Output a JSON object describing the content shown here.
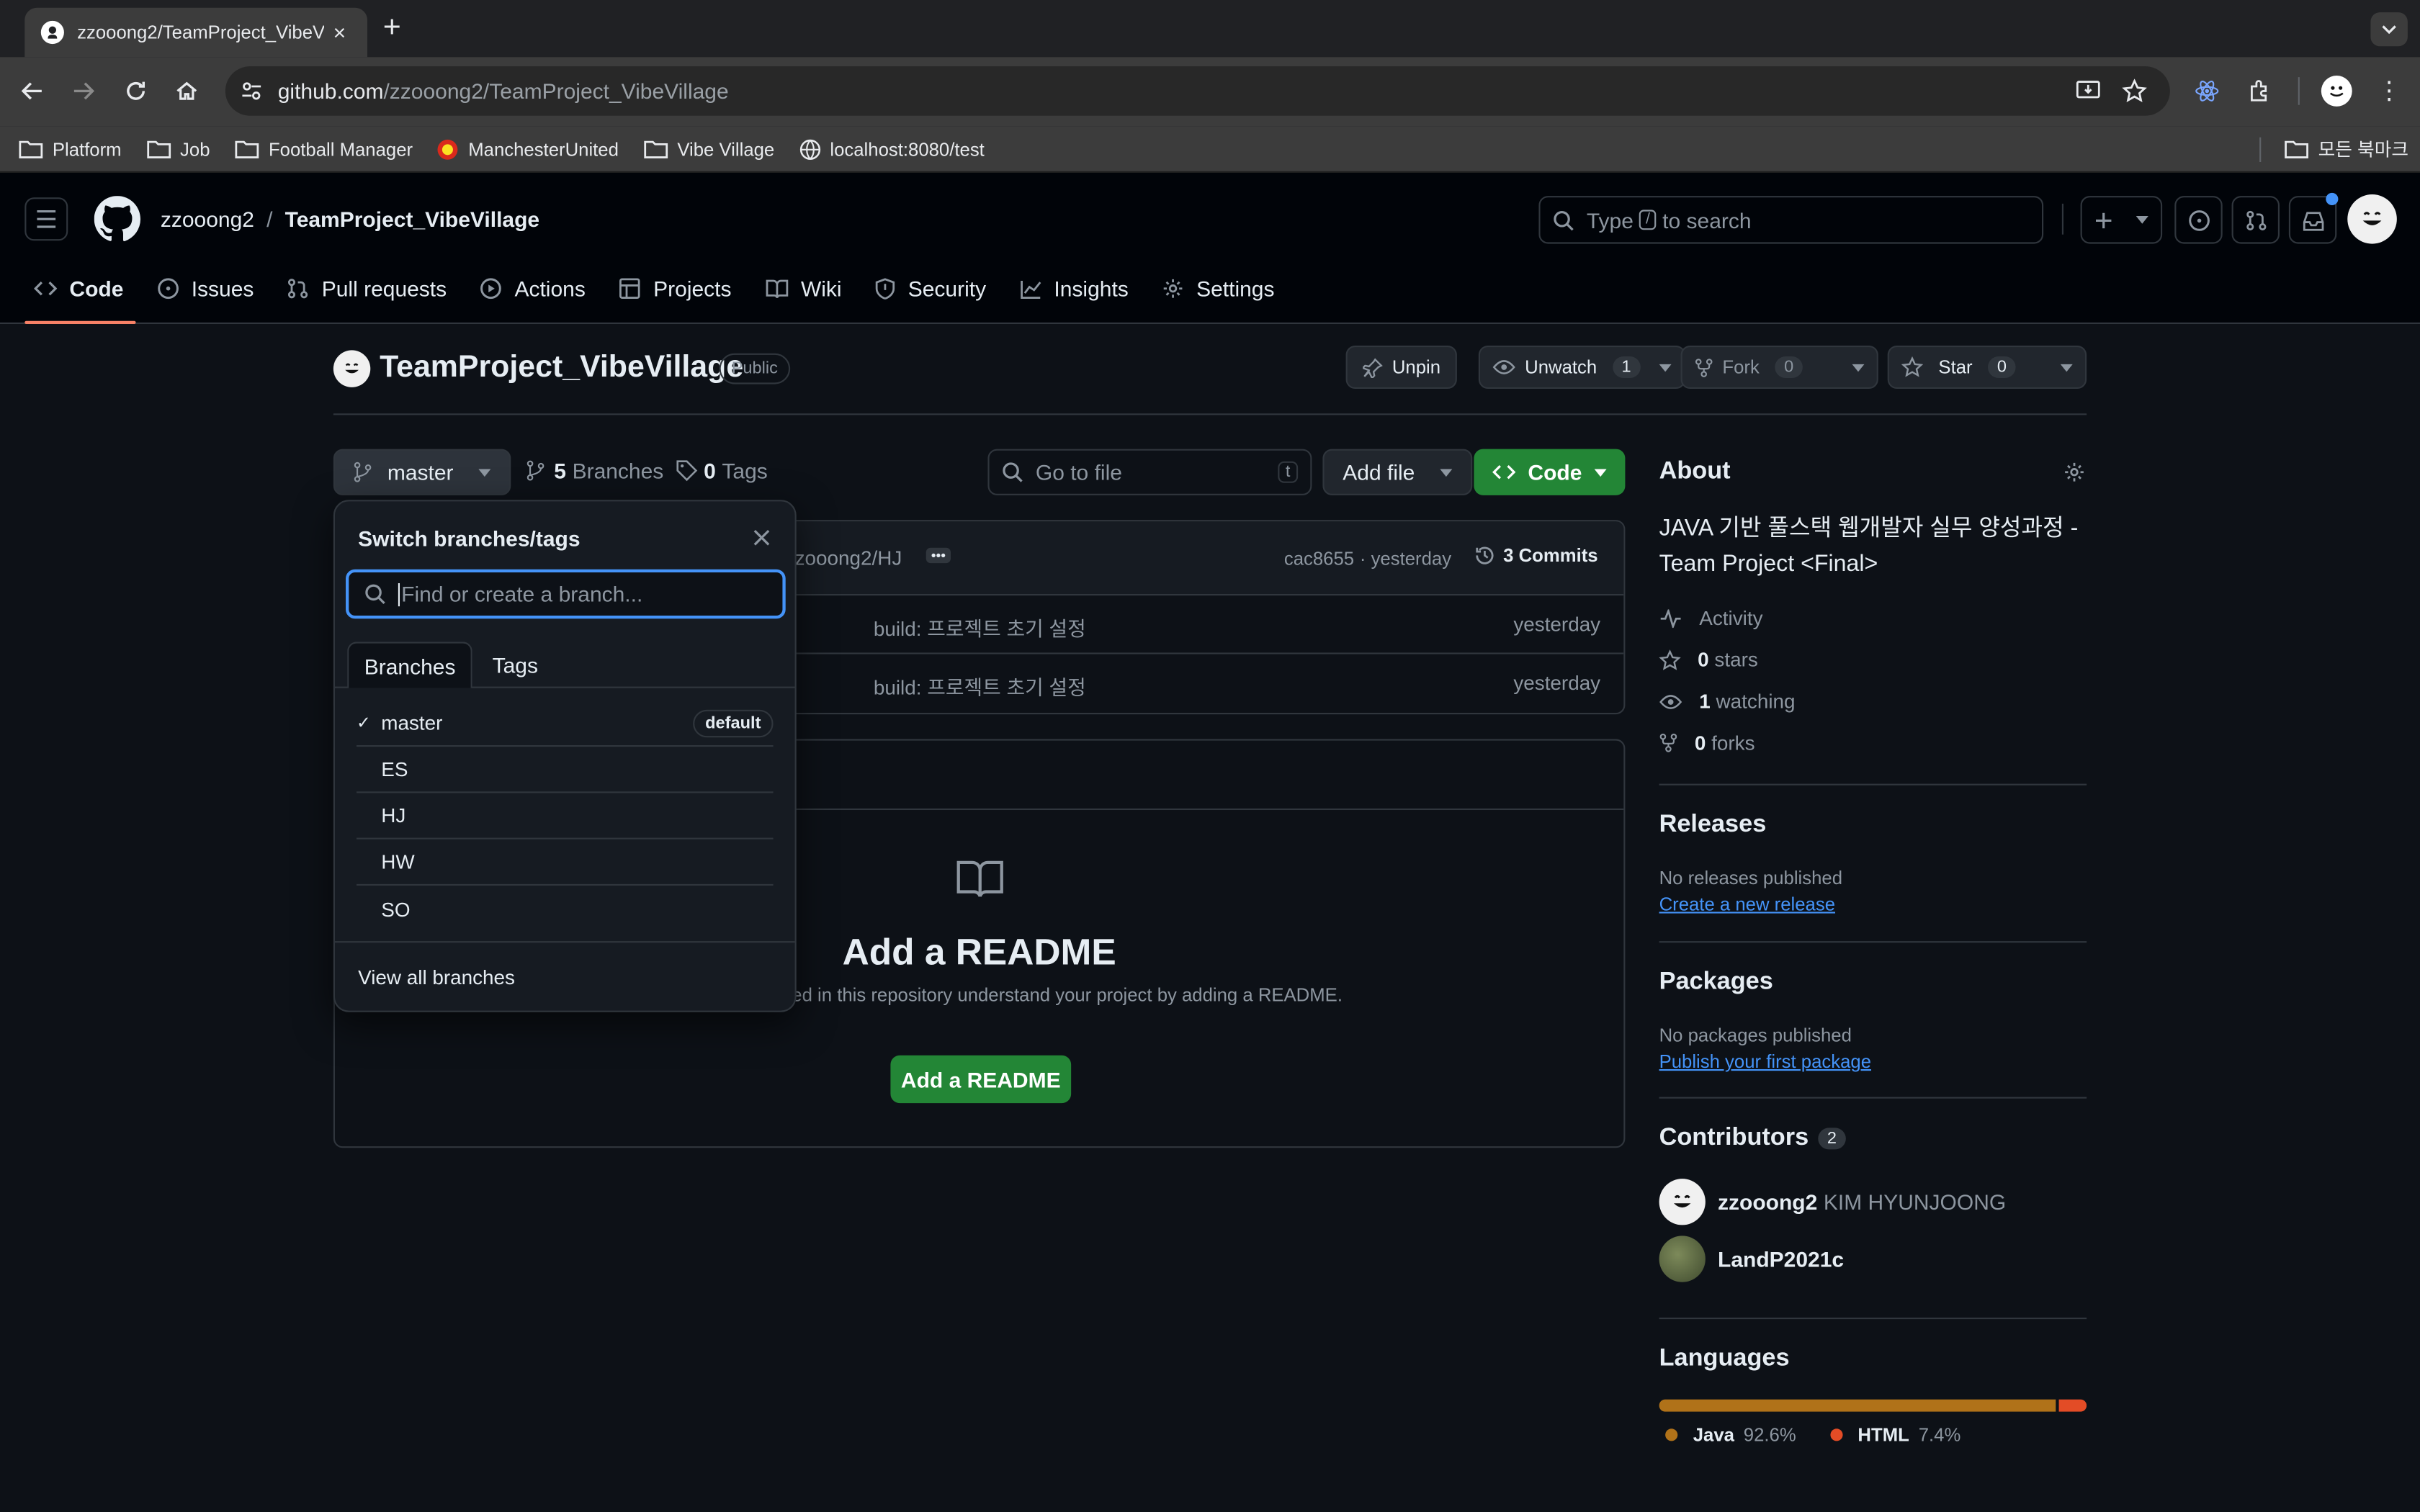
{
  "browser": {
    "tab_title": "zzooong2/TeamProject_VibeV",
    "url_host": "github.com",
    "url_path": "/zzooong2/TeamProject_VibeVillage",
    "bookmarks": [
      {
        "label": "Platform",
        "icon": "folder-icon"
      },
      {
        "label": "Job",
        "icon": "folder-icon"
      },
      {
        "label": "Football Manager",
        "icon": "folder-icon"
      },
      {
        "label": "ManchesterUnited",
        "icon": "manutd-icon"
      },
      {
        "label": "Vibe Village",
        "icon": "folder-icon"
      },
      {
        "label": "localhost:8080/test",
        "icon": "globe-icon"
      }
    ],
    "all_bookmarks": "모든 북마크"
  },
  "header": {
    "owner": "zzooong2",
    "separator": "/",
    "repo": "TeamProject_VibeVillage",
    "search_type": "Type",
    "search_key": "/",
    "search_rest": "to search"
  },
  "nav": {
    "tabs": [
      {
        "label": "Code",
        "icon": "code-icon"
      },
      {
        "label": "Issues",
        "icon": "issue-icon"
      },
      {
        "label": "Pull requests",
        "icon": "pull-request-icon"
      },
      {
        "label": "Actions",
        "icon": "play-icon"
      },
      {
        "label": "Projects",
        "icon": "table-icon"
      },
      {
        "label": "Wiki",
        "icon": "book-icon"
      },
      {
        "label": "Security",
        "icon": "shield-icon"
      },
      {
        "label": "Insights",
        "icon": "graph-icon"
      },
      {
        "label": "Settings",
        "icon": "gear-icon"
      }
    ]
  },
  "repo": {
    "name": "TeamProject_VibeVillage",
    "visibility": "Public",
    "unpin": "Unpin",
    "unwatch": "Unwatch",
    "watch_count": "1",
    "fork": "Fork",
    "fork_count": "0",
    "star": "Star",
    "star_count": "0"
  },
  "toolbar": {
    "branch": "master",
    "branches_count": "5",
    "branches_label": "Branches",
    "tags_count": "0",
    "tags_label": "Tags",
    "goto_placeholder": "Go to file",
    "goto_key": "t",
    "add_file": "Add file",
    "code": "Code"
  },
  "commit": {
    "author_ref": "zooong2/HJ",
    "hash": "cac8655",
    "when": "· yesterday",
    "commits": "3 Commits"
  },
  "files": [
    {
      "message": "build: 프로젝트 초기 설정",
      "when": "yesterday"
    },
    {
      "message": "build: 프로젝트 초기 설정",
      "when": "yesterday"
    }
  ],
  "readme": {
    "title": "Add a README",
    "desc": "ed in this repository understand your project by adding a README.",
    "button": "Add a README"
  },
  "branch_menu": {
    "title": "Switch branches/tags",
    "placeholder": "Find or create a branch...",
    "tab_branches": "Branches",
    "tab_tags": "Tags",
    "check": "✓",
    "default_badge": "default",
    "branches": [
      "master",
      "ES",
      "HJ",
      "HW",
      "SO"
    ],
    "view_all": "View all branches"
  },
  "about": {
    "heading": "About",
    "description": "JAVA 기반 풀스택 웹개발자 실무 양성과정 - Team Project <Final>",
    "activity": "Activity",
    "stars": "0",
    "stars_label": "stars",
    "watching": "1",
    "watching_label": "watching",
    "forks": "0",
    "forks_label": "forks"
  },
  "releases": {
    "heading": "Releases",
    "none": "No releases published",
    "create": "Create a new release"
  },
  "packages": {
    "heading": "Packages",
    "none": "No packages published",
    "publish": "Publish your first package"
  },
  "contributors": {
    "heading": "Contributors",
    "count": "2",
    "list": [
      {
        "login": "zzooong2",
        "name": "KIM HYUNJOONG"
      },
      {
        "login": "LandP2021c",
        "name": ""
      }
    ]
  },
  "languages": {
    "heading": "Languages",
    "items": [
      {
        "name": "Java",
        "percent": "92.6%",
        "value": 92.6,
        "color": "#b07219"
      },
      {
        "name": "HTML",
        "percent": "7.4%",
        "value": 7.4,
        "color": "#e34c26"
      }
    ]
  },
  "colors": {
    "accent_orange": "#f78166",
    "green": "#238636",
    "link": "#4493f8"
  }
}
